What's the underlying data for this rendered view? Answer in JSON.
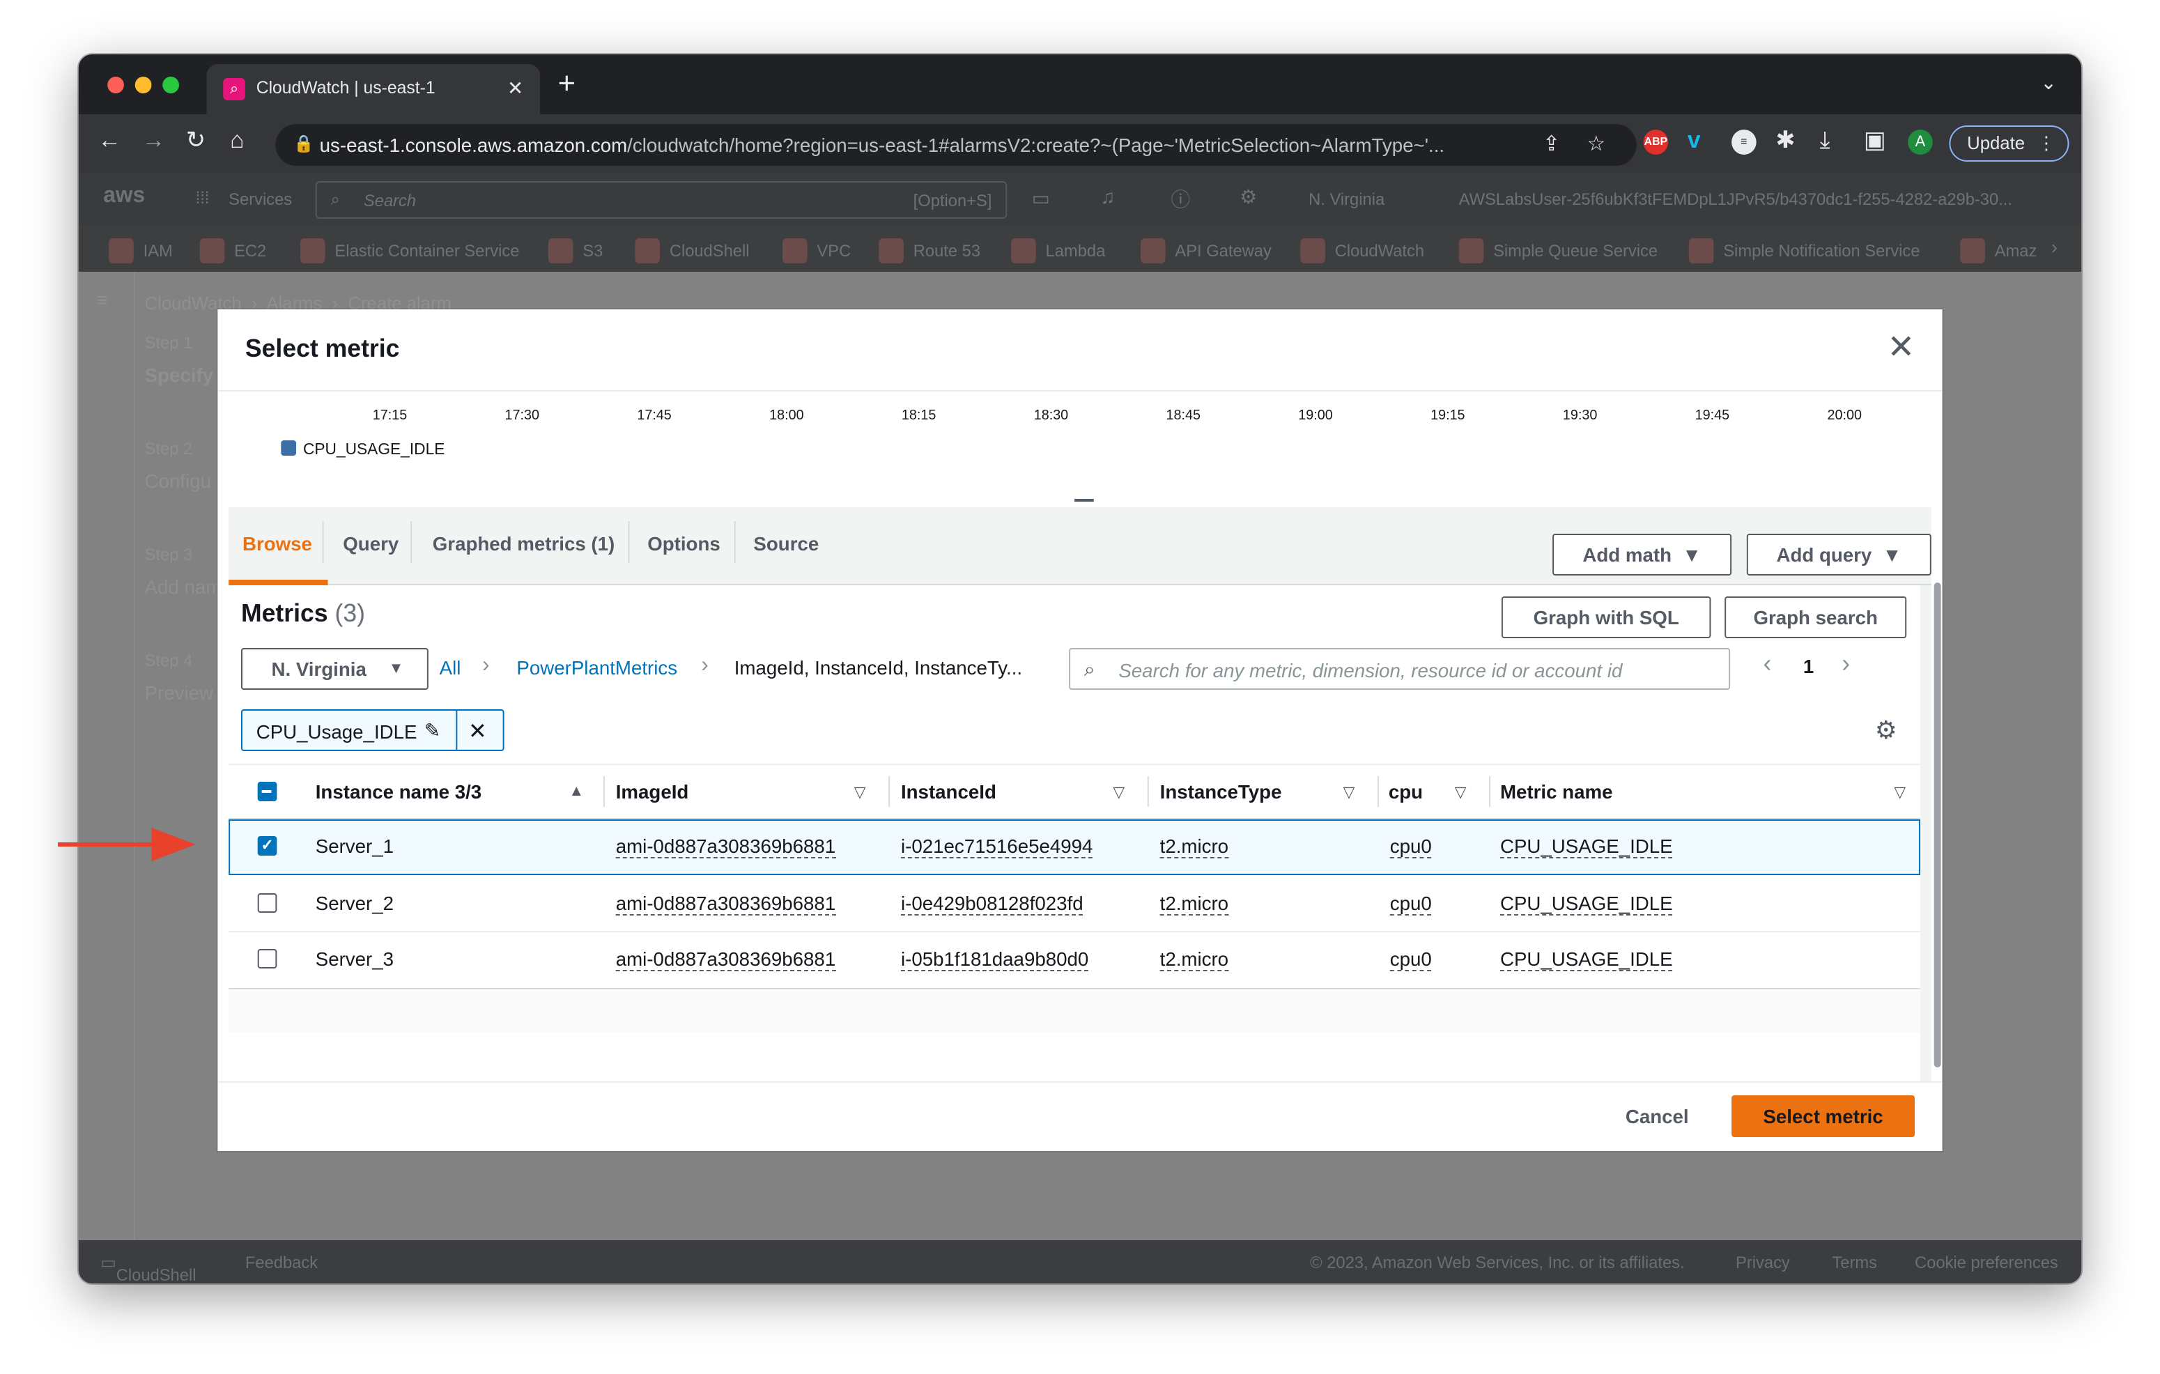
{
  "browser": {
    "tab_title": "CloudWatch | us-east-1",
    "url_host": "us-east-1.console.aws.amazon.com",
    "url_path": "/cloudwatch/home?region=us-east-1#alarmsV2:create?~(Page~'MetricSelection~AlarmType~'...",
    "update_label": "Update",
    "profile_initial": "A",
    "ext_abp": "ABP"
  },
  "aws_nav": {
    "logo": "aws",
    "services_label": "Services",
    "search_placeholder": "Search",
    "search_shortcut": "[Option+S]",
    "region": "N. Virginia",
    "account": "AWSLabsUser-25f6ubKf3tFEMDpL1JPvR5/b4370dc1-f255-4282-a29b-30..."
  },
  "favorites": [
    "IAM",
    "EC2",
    "Elastic Container Service",
    "S3",
    "CloudShell",
    "VPC",
    "Route 53",
    "Lambda",
    "API Gateway",
    "CloudWatch",
    "Simple Queue Service",
    "Simple Notification Service",
    "Amaz"
  ],
  "background": {
    "breadcrumb": [
      "CloudWatch",
      "Alarms",
      "Create alarm"
    ],
    "steps": [
      {
        "step": "Step 1",
        "label": "Specify"
      },
      {
        "step": "Step 2",
        "label": "Configu"
      },
      {
        "step": "Step 3",
        "label": "Add nam"
      },
      {
        "step": "Step 4",
        "label": "Preview"
      }
    ]
  },
  "modal": {
    "title": "Select metric",
    "chart": {
      "ticks": [
        "17:15",
        "17:30",
        "17:45",
        "18:00",
        "18:15",
        "18:30",
        "18:45",
        "19:00",
        "19:15",
        "19:30",
        "19:45",
        "20:00"
      ],
      "legend": "CPU_USAGE_IDLE",
      "series_color": "#3a6ea5"
    },
    "tabs": [
      "Browse",
      "Query",
      "Graphed metrics (1)",
      "Options",
      "Source"
    ],
    "add_math": "Add math",
    "add_query": "Add query",
    "graph_sql": "Graph with SQL",
    "graph_search": "Graph search",
    "metrics_title": "Metrics",
    "metrics_count": "(3)",
    "region_select": "N. Virginia",
    "breadcrumb": [
      "All",
      "PowerPlantMetrics",
      "ImageId, InstanceId, InstanceTy..."
    ],
    "search_placeholder": "Search for any metric, dimension, resource id or account id",
    "page": "1",
    "filter_chip": "CPU_Usage_IDLE",
    "columns": [
      "Instance name 3/3",
      "ImageId",
      "InstanceId",
      "InstanceType",
      "cpu",
      "Metric name"
    ],
    "rows": [
      {
        "name": "Server_1",
        "image": "ami-0d887a308369b6881",
        "instance": "i-021ec71516e5e4994",
        "type": "t2.micro",
        "cpu": "cpu0",
        "metric": "CPU_USAGE_IDLE",
        "checked": true
      },
      {
        "name": "Server_2",
        "image": "ami-0d887a308369b6881",
        "instance": "i-0e429b08128f023fd",
        "type": "t2.micro",
        "cpu": "cpu0",
        "metric": "CPU_USAGE_IDLE",
        "checked": false
      },
      {
        "name": "Server_3",
        "image": "ami-0d887a308369b6881",
        "instance": "i-05b1f181daa9b80d0",
        "type": "t2.micro",
        "cpu": "cpu0",
        "metric": "CPU_USAGE_IDLE",
        "checked": false
      }
    ],
    "cancel": "Cancel",
    "select": "Select metric"
  },
  "footer": {
    "cloudshell": "CloudShell",
    "feedback": "Feedback",
    "copyright": "© 2023, Amazon Web Services, Inc. or its affiliates.",
    "privacy": "Privacy",
    "terms": "Terms",
    "cookie": "Cookie preferences"
  },
  "colors": {
    "accent": "#ec7211",
    "link": "#0073bb",
    "annotation_arrow": "#e8412c"
  }
}
